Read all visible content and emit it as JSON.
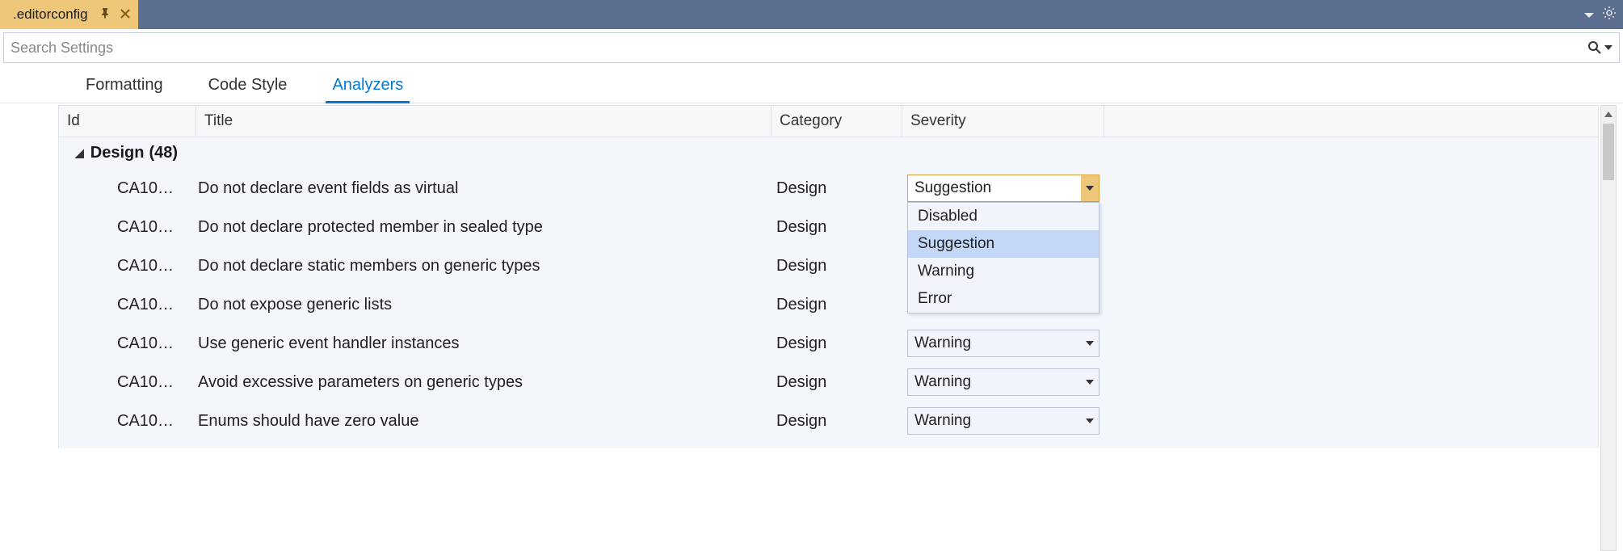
{
  "titlebar": {
    "filename": ".editorconfig"
  },
  "search": {
    "placeholder": "Search Settings"
  },
  "tabs": {
    "items": [
      {
        "label": "Formatting",
        "active": false
      },
      {
        "label": "Code Style",
        "active": false
      },
      {
        "label": "Analyzers",
        "active": true
      }
    ]
  },
  "columns": {
    "id": "Id",
    "title": "Title",
    "category": "Category",
    "severity": "Severity"
  },
  "group": {
    "name": "Design",
    "count": "(48)"
  },
  "rules": [
    {
      "id": "CA10…",
      "title": "Do not declare event fields as virtual",
      "category": "Design",
      "severity": "Suggestion",
      "open": true
    },
    {
      "id": "CA10…",
      "title": "Do not declare protected member in sealed type",
      "category": "Design",
      "severity": ""
    },
    {
      "id": "CA10…",
      "title": "Do not declare static members on generic types",
      "category": "Design",
      "severity": ""
    },
    {
      "id": "CA10…",
      "title": "Do not expose generic lists",
      "category": "Design",
      "severity": ""
    },
    {
      "id": "CA10…",
      "title": "Use generic event handler instances",
      "category": "Design",
      "severity": "Warning"
    },
    {
      "id": "CA10…",
      "title": "Avoid excessive parameters on generic types",
      "category": "Design",
      "severity": "Warning"
    },
    {
      "id": "CA10…",
      "title": "Enums should have zero value",
      "category": "Design",
      "severity": "Warning"
    }
  ],
  "severity_options": [
    "Disabled",
    "Suggestion",
    "Warning",
    "Error"
  ]
}
